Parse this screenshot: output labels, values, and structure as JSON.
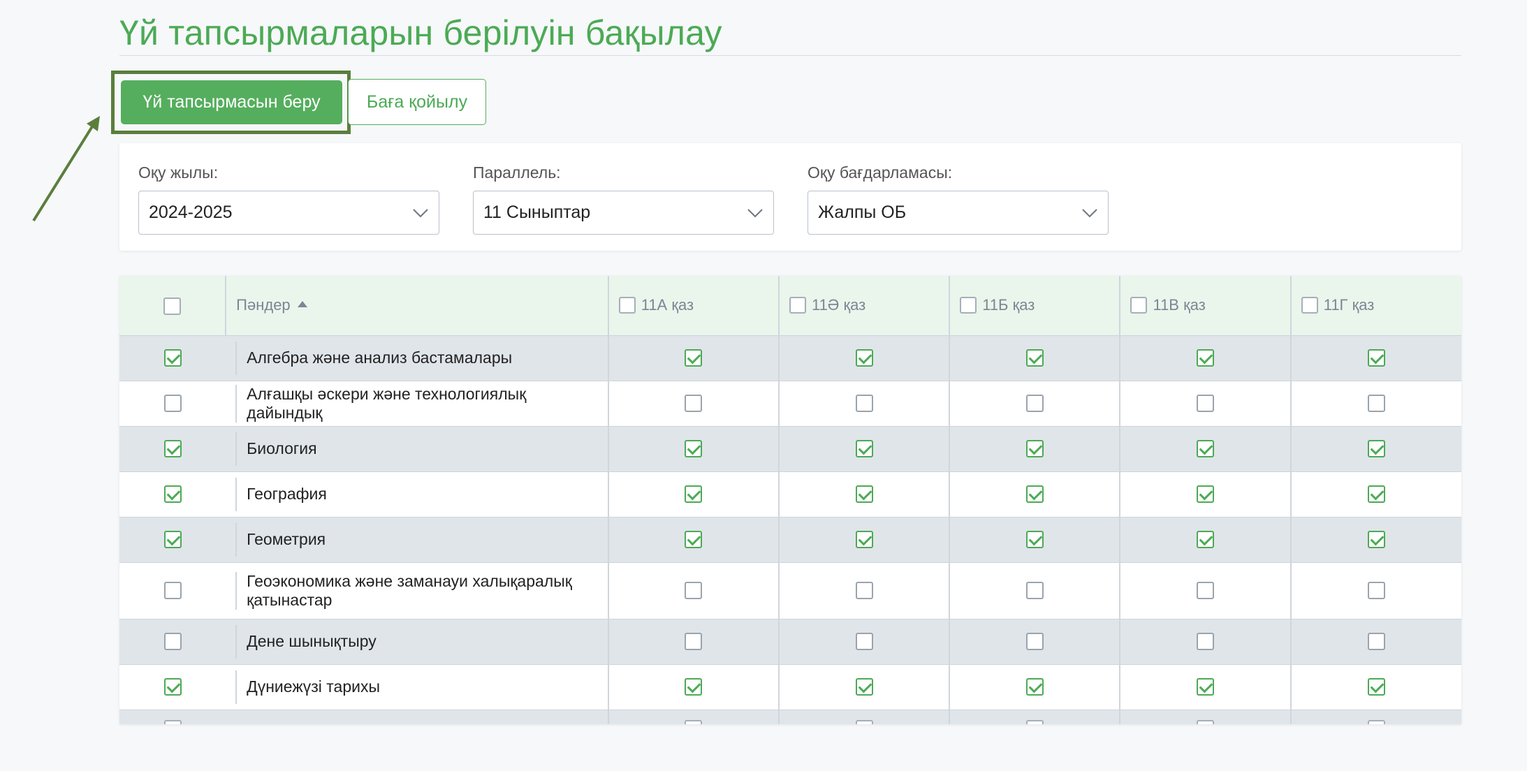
{
  "page": {
    "title": "Үй тапсырмаларын берілуін бақылау"
  },
  "tabs": {
    "primary": "Үй тапсырмасын беру",
    "secondary": "Баға қойылу"
  },
  "filters": {
    "year": {
      "label": "Оқу жылы:",
      "value": "2024-2025"
    },
    "parallel": {
      "label": "Параллель:",
      "value": "11 Сыныптар"
    },
    "program": {
      "label": "Оқу бағдарламасы:",
      "value": "Жалпы ОБ"
    }
  },
  "table": {
    "subject_header": "Пәндер",
    "classes": [
      "11А қаз",
      "11Ә қаз",
      "11Б қаз",
      "11В қаз",
      "11Г қаз"
    ],
    "rows": [
      {
        "subject": "Алгебра және анализ бастамалары",
        "checked": true
      },
      {
        "subject": "Алғашқы әскери және технологиялық дайындық",
        "checked": false
      },
      {
        "subject": "Биология",
        "checked": true
      },
      {
        "subject": "География",
        "checked": true
      },
      {
        "subject": "Геометрия",
        "checked": true
      },
      {
        "subject": "Геоэкономика және заманауи халықаралық қатынастар",
        "checked": false
      },
      {
        "subject": "Дене шынықтыру",
        "checked": false
      },
      {
        "subject": "Дүниежүзі тарихы",
        "checked": true
      }
    ]
  },
  "colors": {
    "accent": "#4caa55",
    "highlight_border": "#5b7e3c",
    "row_alt": "#e0e5ea",
    "header_bg": "#eaf5ec"
  }
}
